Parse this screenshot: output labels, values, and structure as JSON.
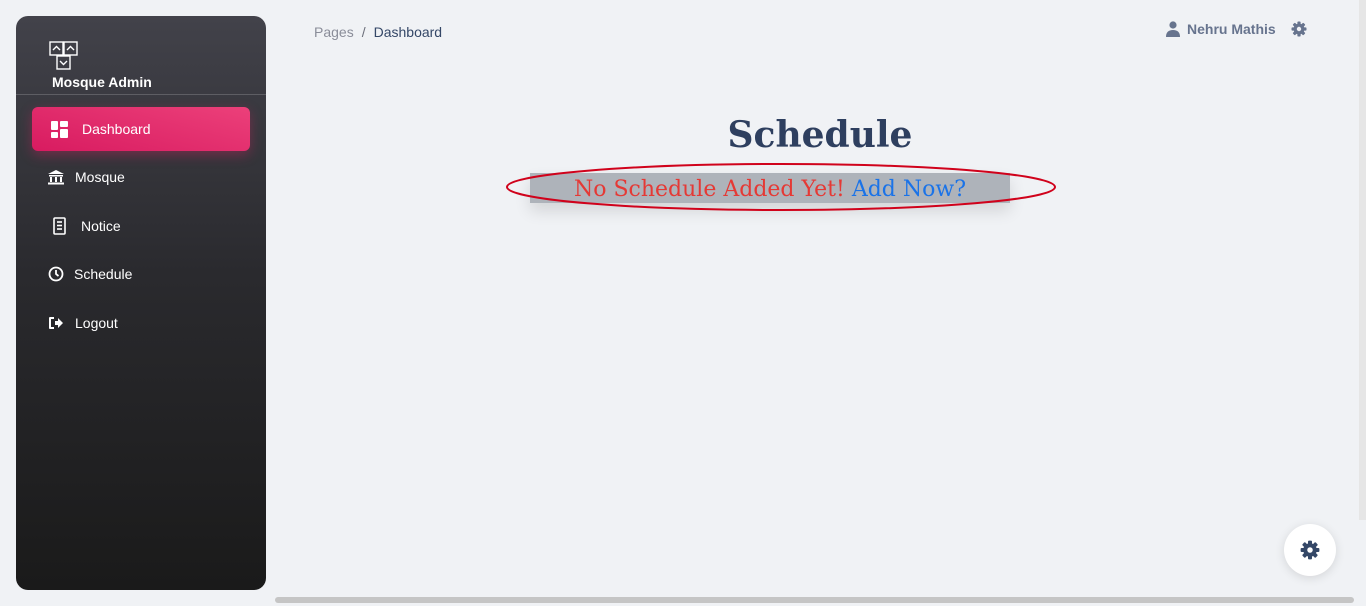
{
  "sidebar": {
    "brand": "Mosque Admin",
    "items": [
      {
        "label": "Dashboard",
        "icon": "dashboard-icon",
        "active": true
      },
      {
        "label": "Mosque",
        "icon": "mosque-icon"
      },
      {
        "label": "Notice",
        "icon": "notice-icon"
      },
      {
        "label": "Schedule",
        "icon": "clock-icon"
      },
      {
        "label": "Logout",
        "icon": "logout-icon"
      }
    ]
  },
  "header": {
    "breadcrumb": {
      "parent": "Pages",
      "separator": "/",
      "current": "Dashboard"
    },
    "user_name": "Nehru Mathis"
  },
  "main": {
    "title": "Schedule",
    "empty_message": "No Schedule Added Yet!",
    "add_link": "Add Now?"
  },
  "colors": {
    "accent": "#e91e63",
    "empty_message": "#e53935",
    "link": "#1a73e8",
    "annotation": "#d0021b"
  }
}
